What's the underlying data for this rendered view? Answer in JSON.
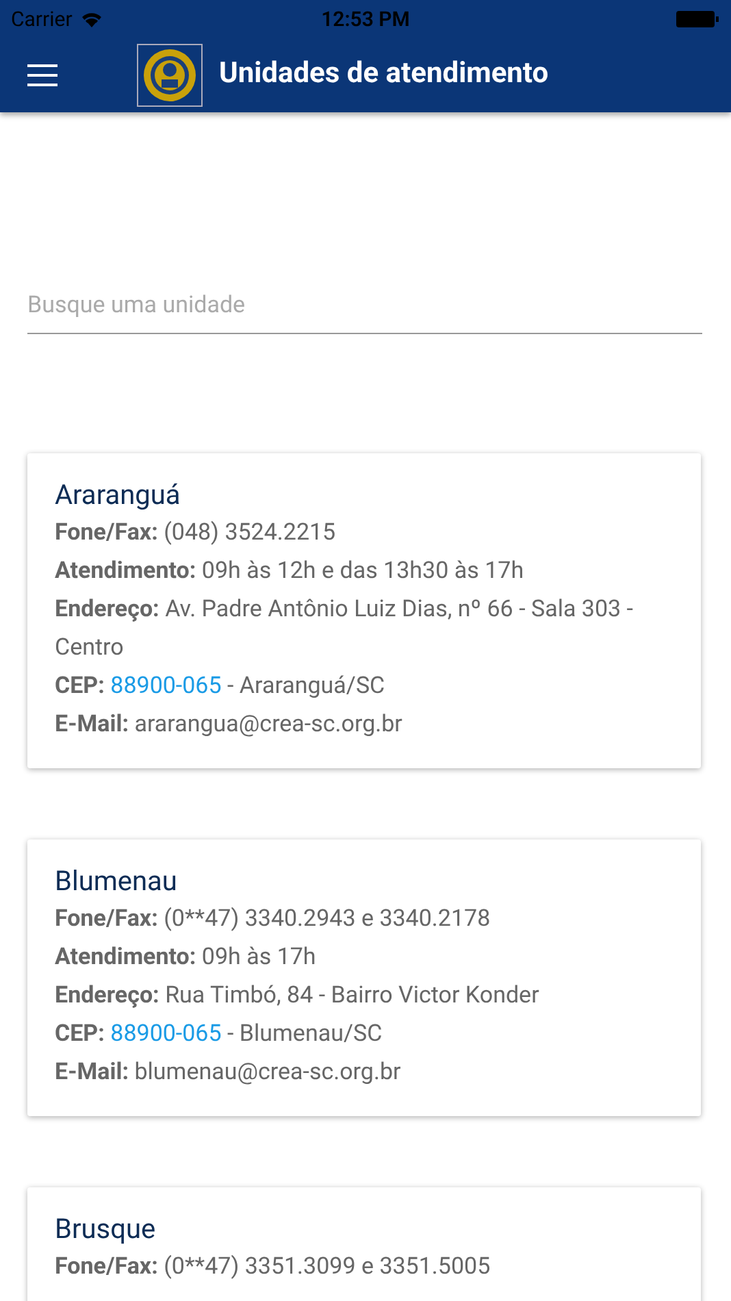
{
  "status_bar": {
    "carrier": "Carrier",
    "time": "12:53 PM"
  },
  "toolbar": {
    "title": "Unidades de atendimento"
  },
  "search": {
    "placeholder": "Busque uma unidade"
  },
  "units": [
    {
      "name": "Araranguá",
      "rows": [
        {
          "kind": "text",
          "label": "Fone/Fax:",
          "value": "(048) 3524.2215"
        },
        {
          "kind": "text",
          "label": "Atendimento:",
          "value": "09h às 12h e das 13h30 às 17h"
        },
        {
          "kind": "text",
          "label": "Endereço:",
          "value": "Av. Padre Antônio Luiz Dias, nº 66 - Sala 303 - Centro"
        },
        {
          "kind": "cep",
          "label": "CEP:",
          "link": "88900-065",
          "value": "- Araranguá/SC"
        },
        {
          "kind": "text",
          "label": "E-Mail:",
          "value": "ararangua@crea-sc.org.br"
        }
      ]
    },
    {
      "name": "Blumenau",
      "rows": [
        {
          "kind": "text",
          "label": "Fone/Fax:",
          "value": "(0**47) 3340.2943 e 3340.2178"
        },
        {
          "kind": "text",
          "label": "Atendimento:",
          "value": "09h às 17h"
        },
        {
          "kind": "text",
          "label": "Endereço:",
          "value": "Rua Timbó, 84 - Bairro Victor Konder"
        },
        {
          "kind": "cep",
          "label": "CEP:",
          "link": "88900-065",
          "value": "- Blumenau/SC"
        },
        {
          "kind": "text",
          "label": "E-Mail:",
          "value": "blumenau@crea-sc.org.br"
        }
      ]
    },
    {
      "name": "Brusque",
      "rows": [
        {
          "kind": "text",
          "label": "Fone/Fax:",
          "value": "(0**47) 3351.3099 e 3351.5005"
        }
      ]
    }
  ]
}
